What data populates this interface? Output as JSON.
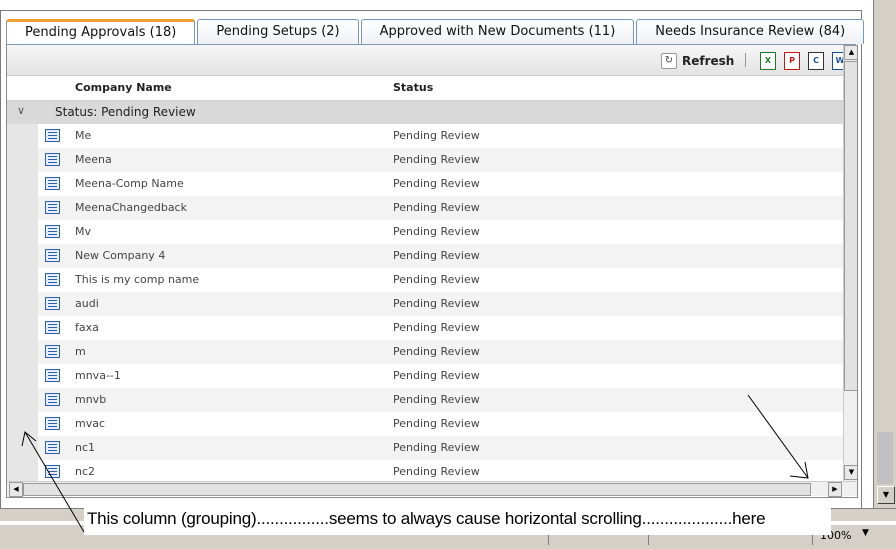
{
  "tabs": [
    {
      "label": "Pending Approvals (18)",
      "active": true
    },
    {
      "label": "Pending Setups (2)",
      "active": false
    },
    {
      "label": "Approved with New Documents (11)",
      "active": false
    },
    {
      "label": "Needs Insurance Review (84)",
      "active": false
    }
  ],
  "toolbar": {
    "refresh_label": "Refresh",
    "export_icons": [
      "excel-export-icon",
      "pdf-export-icon",
      "csv-export-icon",
      "word-export-icon"
    ]
  },
  "grid": {
    "columns": [
      "Company Name",
      "Status"
    ],
    "group_label": "Status: Pending Review",
    "rows": [
      {
        "company": "Me",
        "status": "Pending Review"
      },
      {
        "company": "Meena",
        "status": "Pending Review"
      },
      {
        "company": "Meena-Comp Name",
        "status": "Pending Review"
      },
      {
        "company": "MeenaChangedback",
        "status": "Pending Review"
      },
      {
        "company": "Mv",
        "status": "Pending Review"
      },
      {
        "company": "New Company 4",
        "status": "Pending Review"
      },
      {
        "company": "This is my comp name",
        "status": "Pending Review"
      },
      {
        "company": "audi",
        "status": "Pending Review"
      },
      {
        "company": "faxa",
        "status": "Pending Review"
      },
      {
        "company": "m",
        "status": "Pending Review"
      },
      {
        "company": "mnva--1",
        "status": "Pending Review"
      },
      {
        "company": "mnvb",
        "status": "Pending Review"
      },
      {
        "company": "mvac",
        "status": "Pending Review"
      },
      {
        "company": "nc1",
        "status": "Pending Review"
      },
      {
        "company": "nc2",
        "status": "Pending Review"
      }
    ]
  },
  "annotation": {
    "text": "This column (grouping)................seems to always cause horizontal scrolling....................here"
  },
  "status_bar": {
    "zoom": "100%"
  },
  "colors": {
    "active_tab_accent": "#f0a030",
    "tab_border": "#7a98b5",
    "group_row": "#d9d9d9",
    "alt_row": "#f3f3f3",
    "row_icon": "#2b5fa8"
  }
}
